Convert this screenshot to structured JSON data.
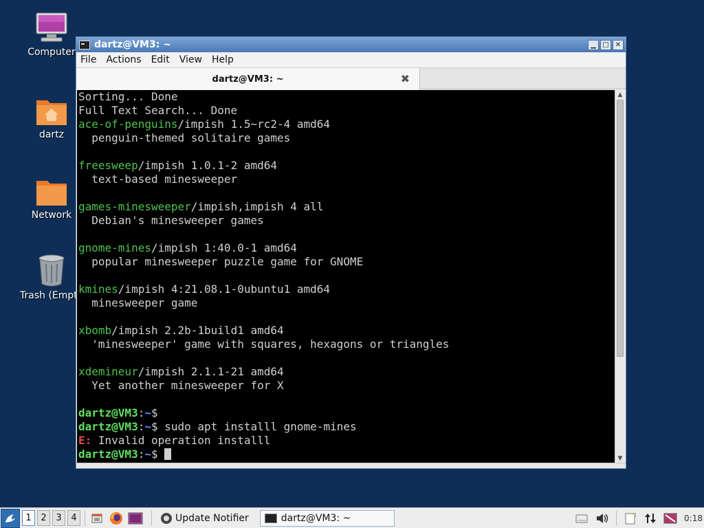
{
  "desktop": {
    "icons": [
      {
        "label": "Computer"
      },
      {
        "label": "dartz"
      },
      {
        "label": "Network"
      },
      {
        "label": "Trash (Empty)"
      }
    ]
  },
  "window": {
    "title": "dartz@VM3: ~",
    "menu": [
      "File",
      "Actions",
      "Edit",
      "View",
      "Help"
    ],
    "tab_title": "dartz@VM3: ~",
    "close_tab": "✖"
  },
  "terminal": {
    "lines": [
      {
        "segments": [
          {
            "text": "Sorting... Done",
            "style": "normal"
          }
        ]
      },
      {
        "segments": [
          {
            "text": "Full Text Search... Done",
            "style": "normal"
          }
        ]
      },
      {
        "segments": [
          {
            "text": "ace-of-penguins",
            "style": "green"
          },
          {
            "text": "/impish 1.5~rc2-4 amd64",
            "style": "normal"
          }
        ]
      },
      {
        "segments": [
          {
            "text": "  penguin-themed solitaire games",
            "style": "normal"
          }
        ]
      },
      {
        "segments": [
          {
            "text": "",
            "style": "normal"
          }
        ]
      },
      {
        "segments": [
          {
            "text": "freesweep",
            "style": "green"
          },
          {
            "text": "/impish 1.0.1-2 amd64",
            "style": "normal"
          }
        ]
      },
      {
        "segments": [
          {
            "text": "  text-based minesweeper",
            "style": "normal"
          }
        ]
      },
      {
        "segments": [
          {
            "text": "",
            "style": "normal"
          }
        ]
      },
      {
        "segments": [
          {
            "text": "games-minesweeper",
            "style": "green"
          },
          {
            "text": "/impish,impish 4 all",
            "style": "normal"
          }
        ]
      },
      {
        "segments": [
          {
            "text": "  Debian's minesweeper games",
            "style": "normal"
          }
        ]
      },
      {
        "segments": [
          {
            "text": "",
            "style": "normal"
          }
        ]
      },
      {
        "segments": [
          {
            "text": "gnome-mines",
            "style": "green"
          },
          {
            "text": "/impish 1:40.0-1 amd64",
            "style": "normal"
          }
        ]
      },
      {
        "segments": [
          {
            "text": "  popular minesweeper puzzle game for GNOME",
            "style": "normal"
          }
        ]
      },
      {
        "segments": [
          {
            "text": "",
            "style": "normal"
          }
        ]
      },
      {
        "segments": [
          {
            "text": "kmines",
            "style": "green"
          },
          {
            "text": "/impish 4:21.08.1-0ubuntu1 amd64",
            "style": "normal"
          }
        ]
      },
      {
        "segments": [
          {
            "text": "  minesweeper game",
            "style": "normal"
          }
        ]
      },
      {
        "segments": [
          {
            "text": "",
            "style": "normal"
          }
        ]
      },
      {
        "segments": [
          {
            "text": "xbomb",
            "style": "green"
          },
          {
            "text": "/impish 2.2b-1build1 amd64",
            "style": "normal"
          }
        ]
      },
      {
        "segments": [
          {
            "text": "  'minesweeper' game with squares, hexagons or triangles",
            "style": "normal"
          }
        ]
      },
      {
        "segments": [
          {
            "text": "",
            "style": "normal"
          }
        ]
      },
      {
        "segments": [
          {
            "text": "xdemineur",
            "style": "green"
          },
          {
            "text": "/impish 2.1.1-21 amd64",
            "style": "normal"
          }
        ]
      },
      {
        "segments": [
          {
            "text": "  Yet another minesweeper for X",
            "style": "normal"
          }
        ]
      },
      {
        "segments": [
          {
            "text": "",
            "style": "normal"
          }
        ]
      },
      {
        "segments": [
          {
            "text": "dartz@VM3",
            "style": "prompt-user"
          },
          {
            "text": ":",
            "style": "normal"
          },
          {
            "text": "~",
            "style": "prompt-path"
          },
          {
            "text": "$ ",
            "style": "normal"
          }
        ]
      },
      {
        "segments": [
          {
            "text": "dartz@VM3",
            "style": "prompt-user"
          },
          {
            "text": ":",
            "style": "normal"
          },
          {
            "text": "~",
            "style": "prompt-path"
          },
          {
            "text": "$ sudo apt installl gnome-mines",
            "style": "normal"
          }
        ]
      },
      {
        "segments": [
          {
            "text": "E:",
            "style": "error"
          },
          {
            "text": " Invalid operation installl",
            "style": "normal"
          }
        ]
      },
      {
        "segments": [
          {
            "text": "dartz@VM3",
            "style": "prompt-user"
          },
          {
            "text": ":",
            "style": "normal"
          },
          {
            "text": "~",
            "style": "prompt-path"
          },
          {
            "text": "$ ",
            "style": "normal"
          }
        ],
        "cursor": true
      }
    ]
  },
  "taskbar": {
    "workspaces": [
      "1",
      "2",
      "3",
      "4"
    ],
    "active_workspace": "1",
    "tasks": [
      {
        "label": "Update Notifier",
        "active": false
      },
      {
        "label": "dartz@VM3: ~",
        "active": true
      }
    ],
    "clock": "0:18"
  },
  "colors": {
    "desktop_bg": "#0e2e57",
    "titlebar": "#4a79b5",
    "term_green": "#4ec24e",
    "term_blue": "#6a8cff",
    "term_red": "#e04c4c"
  }
}
